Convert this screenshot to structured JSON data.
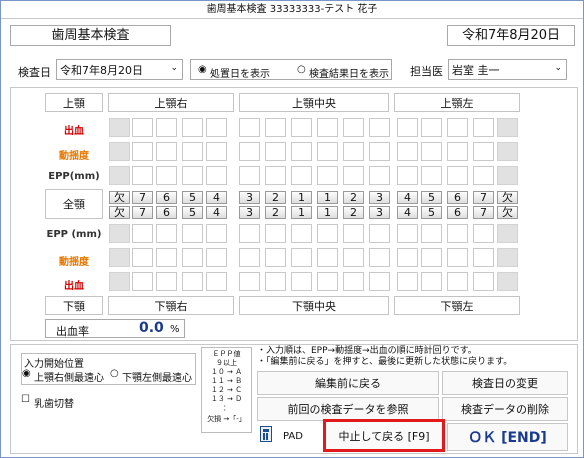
{
  "window": {
    "title": "歯周基本検査 33333333-テスト 花子"
  },
  "header": {
    "heading": "歯周基本検査",
    "date_display": "令和7年8月20日"
  },
  "controls": {
    "exam_date_label": "検査日",
    "exam_date_value": "令和7年8月20日",
    "radio_treatment": "処置日を表示",
    "radio_result": "検査結果日を表示",
    "doctor_label": "担当医",
    "doctor_value": "岩室 圭一"
  },
  "jaw": {
    "upper": "上顎",
    "upper_right": "上顎右",
    "upper_center": "上顎中央",
    "upper_left": "上顎左",
    "lower": "下顎",
    "lower_right": "下顎右",
    "lower_center": "下顎中央",
    "lower_left": "下顎左"
  },
  "rows": {
    "bleeding": "出血",
    "mobility": "動揺度",
    "epp_upper": "EPP(mm)",
    "full_jaw": "全顎",
    "epp_lower": "EPP (mm)",
    "mobility_lower": "動揺度",
    "bleeding_lower": "出血"
  },
  "teeth": {
    "upper": [
      "欠",
      "7",
      "6",
      "5",
      "4",
      "3",
      "2",
      "1",
      "1",
      "2",
      "3",
      "4",
      "5",
      "6",
      "7",
      "欠"
    ],
    "lower": [
      "欠",
      "7",
      "6",
      "5",
      "4",
      "3",
      "2",
      "1",
      "1",
      "2",
      "3",
      "4",
      "5",
      "6",
      "7",
      "欠"
    ]
  },
  "bleeding_rate": {
    "label": "出血率",
    "value": "0.0",
    "unit": "%"
  },
  "input_start": {
    "label": "入力開始位置",
    "opt1": "上顎右側最遠心",
    "opt2": "下顎左側最遠心",
    "baby_teeth": "乳歯切替"
  },
  "epp_legend": {
    "title": "ＥＰＰ値",
    "l1": "９以上",
    "l2": "１０ → Ａ",
    "l3": "１１ → Ｂ",
    "l4": "１２ → Ｃ",
    "l5": "１３ → Ｄ",
    "l6": "：",
    "missing": "欠損 →「-」"
  },
  "notes": {
    "line1": "・入力順は、EPP→動揺度→出血の順に時計回りです。",
    "line2": "・「編集前に戻る」を押すと、最後に更新した状態に戻ります。"
  },
  "buttons": {
    "revert": "編集前に戻る",
    "change_date": "検査日の変更",
    "reference": "前回の検査データを参照",
    "delete": "検査データの削除",
    "pad": "PAD",
    "cancel": "中止して戻る [F9]",
    "ok": "ＯＫ [END]"
  },
  "colors": {
    "highlight": "#e11b1b",
    "ok_text": "#1a3a8f",
    "bleeding": "#d40000",
    "mobility": "#e67800"
  }
}
